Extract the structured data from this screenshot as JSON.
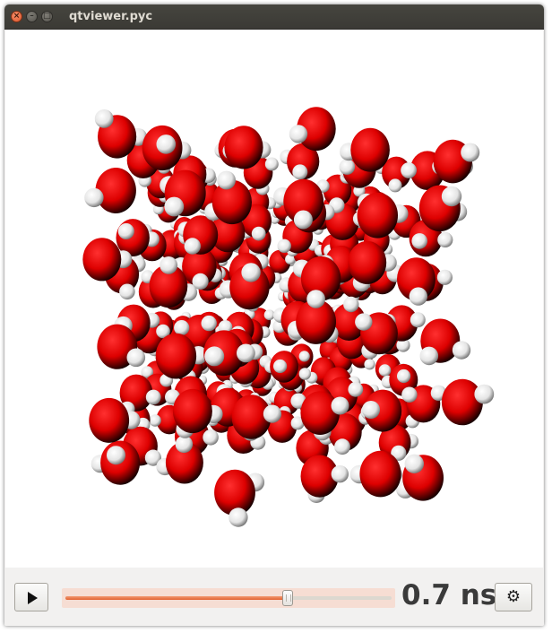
{
  "window": {
    "title": "qtviewer.pyc",
    "close_glyph": "×",
    "minimize_glyph": "–",
    "maximize_glyph": "□"
  },
  "viewer": {
    "content": "water-molecules-3d",
    "oxygen_color": "#e00000",
    "hydrogen_color": "#f0f0f0",
    "background_color": "#ffffff"
  },
  "controls": {
    "play_icon": "play-icon",
    "slider_value": 0.68,
    "time_label": "0.7 ns",
    "settings_icon": "gear-icon",
    "settings_glyph": "⚙",
    "accent_color": "#e2602f"
  }
}
